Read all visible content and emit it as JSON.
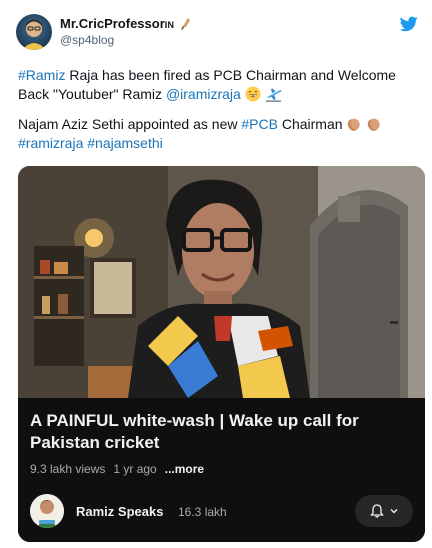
{
  "tweet": {
    "author_name": "Mr.CricProfessor",
    "author_suffix": "IN",
    "author_handle": "@sp4blog",
    "p1_tag": "#Ramiz",
    "p1_text_a": " Raja has been fired as PCB Chairman and Welcome Back \"Youtuber\" Ramiz ",
    "p1_mention": "@iramizraja",
    "p2_text_a": "Najam Aziz Sethi appointed as new ",
    "p2_tag": "#PCB",
    "p2_text_b": " Chairman ",
    "p2_tag2": "#ramizraja",
    "p2_tag3": "#najamsethi"
  },
  "video": {
    "title": "A PAINFUL white-wash | Wake up call for Pakistan cricket",
    "views": "9.3 lakh views",
    "age": "1 yr ago",
    "more": "...more",
    "channel_name": "Ramiz Speaks",
    "subscribers": "16.3 lakh"
  },
  "icons": {
    "platform": "twitter-bird-icon",
    "name_emoji": "cricket-bat-icon",
    "emoji1": "grinning-face-icon",
    "emoji2": "airplane-departure-icon",
    "emoji3": "clapping-hands-icon",
    "bell": "notification-bell-icon",
    "chevron": "chevron-down-icon"
  },
  "colors": {
    "link": "#1b74b8",
    "twitter_blue": "#1d9bf0",
    "video_panel": "#0f0f0f"
  }
}
